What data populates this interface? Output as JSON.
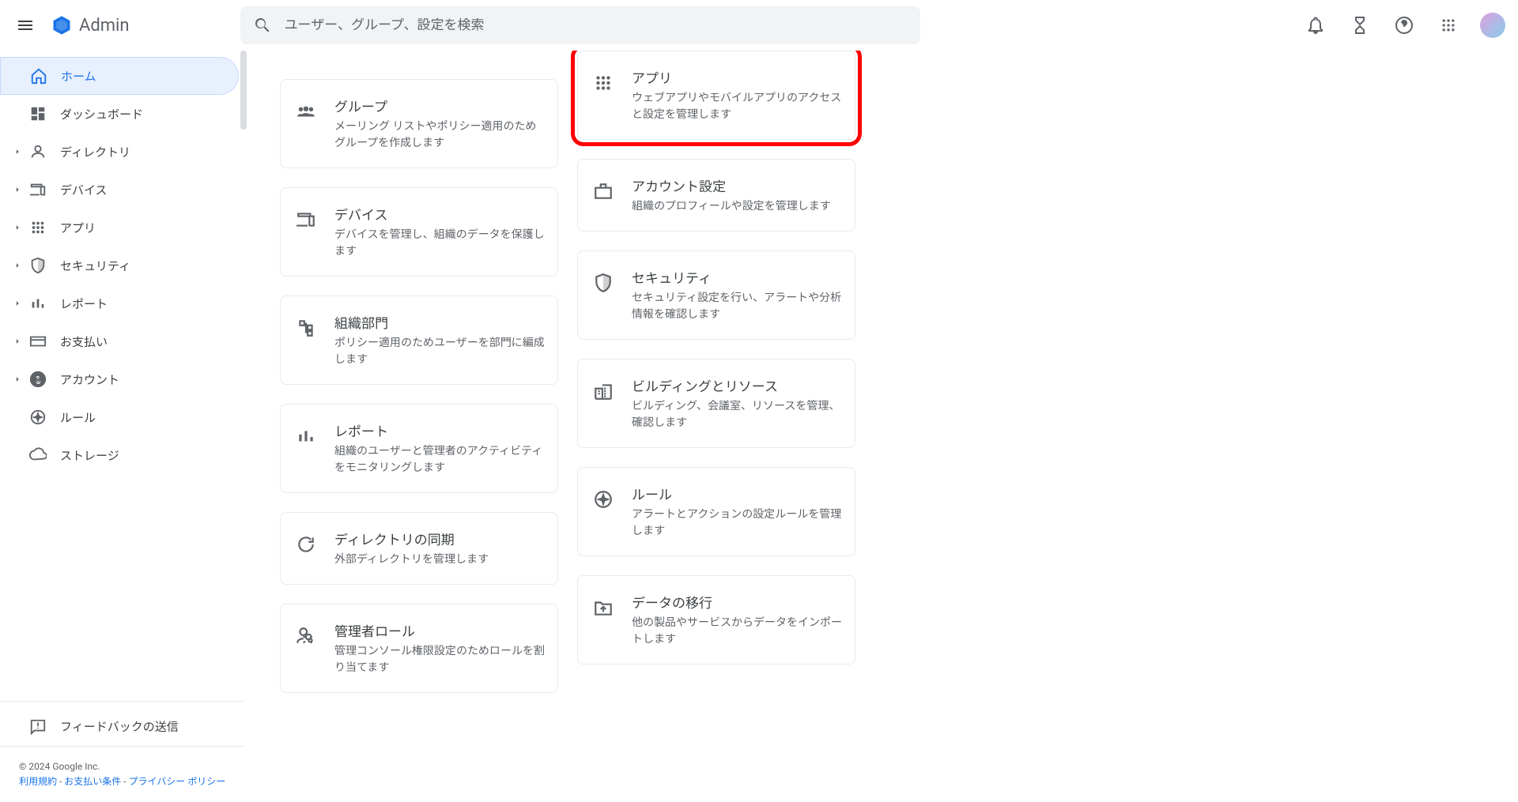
{
  "header": {
    "logo_text": "Admin",
    "search_placeholder": "ユーザー、グループ、設定を検索"
  },
  "sidebar": {
    "items": [
      {
        "label": "ホーム",
        "icon": "home",
        "active": true,
        "expandable": false
      },
      {
        "label": "ダッシュボード",
        "icon": "dashboard",
        "active": false,
        "expandable": false
      },
      {
        "label": "ディレクトリ",
        "icon": "person",
        "active": false,
        "expandable": true
      },
      {
        "label": "デバイス",
        "icon": "devices",
        "active": false,
        "expandable": true
      },
      {
        "label": "アプリ",
        "icon": "apps",
        "active": false,
        "expandable": true
      },
      {
        "label": "セキュリティ",
        "icon": "security",
        "active": false,
        "expandable": true
      },
      {
        "label": "レポート",
        "icon": "analytics",
        "active": false,
        "expandable": true
      },
      {
        "label": "お支払い",
        "icon": "payment",
        "active": false,
        "expandable": true
      },
      {
        "label": "アカウント",
        "icon": "account",
        "active": false,
        "expandable": true
      },
      {
        "label": "ルール",
        "icon": "rules",
        "active": false,
        "expandable": false
      },
      {
        "label": "ストレージ",
        "icon": "storage",
        "active": false,
        "expandable": false
      }
    ],
    "feedback_label": "フィードバックの送信",
    "footer": {
      "copyright": "© 2024 Google Inc.",
      "links": [
        "利用規約",
        "お支払い条件",
        "プライバシー ポリシー"
      ],
      "separator": " - "
    }
  },
  "cards": {
    "left_column": [
      {
        "title": "グループ",
        "desc": "メーリング リストやポリシー適用のためグループを作成します",
        "icon": "groups"
      },
      {
        "title": "デバイス",
        "desc": "デバイスを管理し、組織のデータを保護します",
        "icon": "devices"
      },
      {
        "title": "組織部門",
        "desc": "ポリシー適用のためユーザーを部門に編成します",
        "icon": "org"
      },
      {
        "title": "レポート",
        "desc": "組織のユーザーと管理者のアクティビティをモニタリングします",
        "icon": "analytics"
      },
      {
        "title": "ディレクトリの同期",
        "desc": "外部ディレクトリを管理します",
        "icon": "sync"
      },
      {
        "title": "管理者ロール",
        "desc": "管理コンソール権限設定のためロールを割り当てます",
        "icon": "admin"
      }
    ],
    "right_column": [
      {
        "title": "アプリ",
        "desc": "ウェブアプリやモバイルアプリのアクセスと設定を管理します",
        "icon": "apps",
        "highlighted": true
      },
      {
        "title": "アカウント設定",
        "desc": "組織のプロフィールや設定を管理します",
        "icon": "briefcase"
      },
      {
        "title": "セキュリティ",
        "desc": "セキュリティ設定を行い、アラートや分析情報を確認します",
        "icon": "security"
      },
      {
        "title": "ビルディングとリソース",
        "desc": "ビルディング、会議室、リソースを管理、確認します",
        "icon": "building"
      },
      {
        "title": "ルール",
        "desc": "アラートとアクションの設定ルールを管理します",
        "icon": "rules"
      },
      {
        "title": "データの移行",
        "desc": "他の製品やサービスからデータをインポートします",
        "icon": "migrate"
      }
    ]
  }
}
